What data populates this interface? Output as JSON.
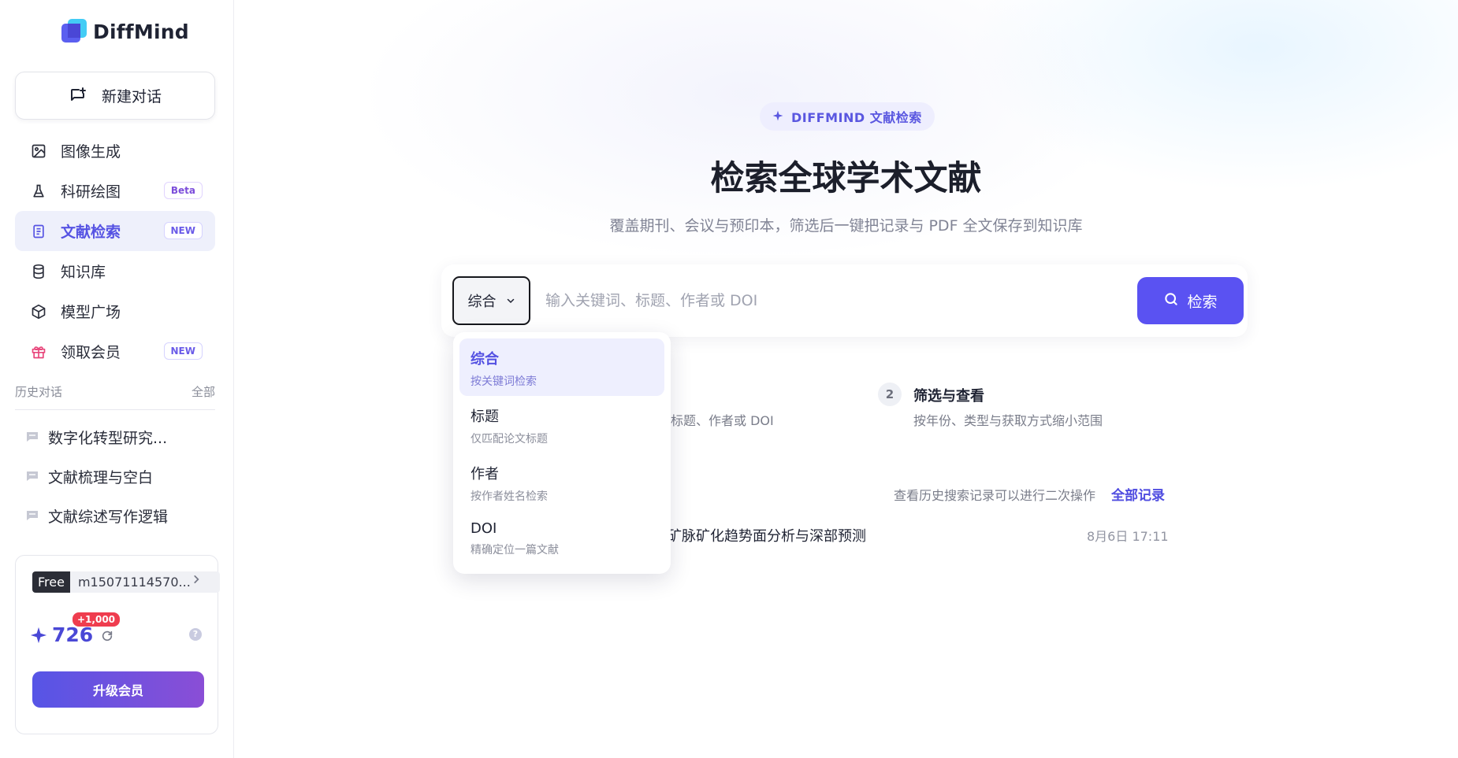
{
  "brand": {
    "name": "DiffMind"
  },
  "sidebar": {
    "new_chat_label": "新建对话",
    "items": [
      {
        "label": "图像生成",
        "icon": "image-icon"
      },
      {
        "label": "科研绘图",
        "icon": "flask-icon",
        "badge": "Beta"
      },
      {
        "label": "文献检索",
        "icon": "document-icon",
        "badge": "NEW",
        "active": true
      },
      {
        "label": "知识库",
        "icon": "database-icon"
      },
      {
        "label": "模型广场",
        "icon": "cube-icon"
      },
      {
        "label": "领取会员",
        "icon": "gift-icon",
        "badge": "NEW"
      }
    ],
    "history": {
      "title": "历史对话",
      "all_label": "全部",
      "items": [
        {
          "label": "数字化转型研究..."
        },
        {
          "label": "文献梳理与空白"
        },
        {
          "label": "文献综述写作逻辑"
        }
      ]
    },
    "user": {
      "plan": "Free",
      "username": "m15071114570...",
      "credits": "726",
      "bonus": "+1,000",
      "upgrade_label": "升级会员"
    }
  },
  "main": {
    "tag": "DIFFMIND 文献检索",
    "title": "检索全球学术文献",
    "subtitle": "覆盖期刊、会议与预印本，筛选后一键把记录与 PDF 全文保存到知识库",
    "search": {
      "scope_value": "综合",
      "placeholder": "输入关键词、标题、作者或 DOI",
      "button_label": "检索"
    },
    "dropdown": [
      {
        "label": "综合",
        "desc": "按关键词检索",
        "selected": true
      },
      {
        "label": "标题",
        "desc": "仅匹配论文标题"
      },
      {
        "label": "作者",
        "desc": "按作者姓名检索"
      },
      {
        "label": "DOI",
        "desc": "精确定位一篇文献"
      }
    ],
    "steps": {
      "step1_desc_partial": "标题、作者或 DOI",
      "step2": {
        "num": "2",
        "title": "筛选与查看",
        "desc": "按年份、类型与获取方式缩小范围"
      }
    },
    "history": {
      "hint": "查看历史搜索记录可以进行二次操作",
      "all_label": "全部记录",
      "record": {
        "title": "矿脉矿化趋势面分析与深部预测",
        "time": "8月6日 17:11"
      }
    }
  },
  "colors": {
    "accent": "#5a52f2",
    "active_bg": "#eef0fb",
    "bonus": "#ef3d4f"
  }
}
